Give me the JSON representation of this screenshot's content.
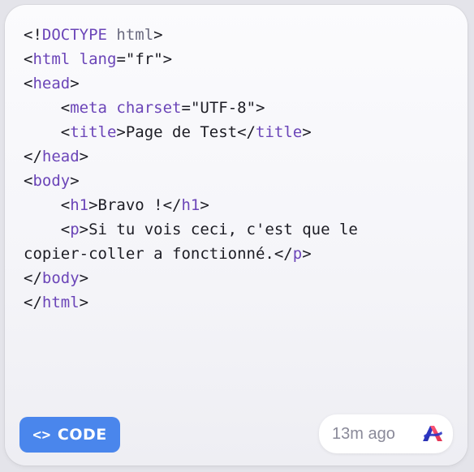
{
  "code_lines": [
    [
      {
        "t": "<!",
        "c": "punct"
      },
      {
        "t": "DOCTYPE",
        "c": "kw"
      },
      {
        "t": " html",
        "c": "dim"
      },
      {
        "t": ">",
        "c": "punct"
      }
    ],
    [
      {
        "t": "<",
        "c": "punct"
      },
      {
        "t": "html",
        "c": "kw"
      },
      {
        "t": " ",
        "c": "punct"
      },
      {
        "t": "lang",
        "c": "at"
      },
      {
        "t": "=\"fr\">",
        "c": "punct"
      }
    ],
    [
      {
        "t": "<",
        "c": "punct"
      },
      {
        "t": "head",
        "c": "kw"
      },
      {
        "t": ">",
        "c": "punct"
      }
    ],
    [
      {
        "t": "    <",
        "c": "punct"
      },
      {
        "t": "meta",
        "c": "kw"
      },
      {
        "t": " ",
        "c": "punct"
      },
      {
        "t": "charset",
        "c": "at"
      },
      {
        "t": "=\"UTF-8\">",
        "c": "punct"
      }
    ],
    [
      {
        "t": "    <",
        "c": "punct"
      },
      {
        "t": "title",
        "c": "kw"
      },
      {
        "t": ">Page de Test</",
        "c": "punct"
      },
      {
        "t": "title",
        "c": "kw"
      },
      {
        "t": ">",
        "c": "punct"
      }
    ],
    [
      {
        "t": "</",
        "c": "punct"
      },
      {
        "t": "head",
        "c": "kw"
      },
      {
        "t": ">",
        "c": "punct"
      }
    ],
    [
      {
        "t": "<",
        "c": "punct"
      },
      {
        "t": "body",
        "c": "kw"
      },
      {
        "t": ">",
        "c": "punct"
      }
    ],
    [
      {
        "t": "    <",
        "c": "punct"
      },
      {
        "t": "h1",
        "c": "kw"
      },
      {
        "t": ">Bravo !</",
        "c": "punct"
      },
      {
        "t": "h1",
        "c": "kw"
      },
      {
        "t": ">",
        "c": "punct"
      }
    ],
    [
      {
        "t": "    <",
        "c": "punct"
      },
      {
        "t": "p",
        "c": "kw"
      },
      {
        "t": ">Si tu vois ceci, c'est que le",
        "c": "punct"
      }
    ],
    [
      {
        "t": "copier-coller a fonctionné.</",
        "c": "punct"
      },
      {
        "t": "p",
        "c": "kw"
      },
      {
        "t": ">",
        "c": "punct"
      }
    ],
    [
      {
        "t": "</",
        "c": "punct"
      },
      {
        "t": "body",
        "c": "kw"
      },
      {
        "t": ">",
        "c": "punct"
      }
    ],
    [
      {
        "t": "</",
        "c": "punct"
      },
      {
        "t": "html",
        "c": "kw"
      },
      {
        "t": ">",
        "c": "punct"
      }
    ]
  ],
  "badge": {
    "icon": "<>",
    "icon_name": "code-brackets-icon",
    "label": "CODE",
    "color": "#4a86ec"
  },
  "meta": {
    "time": "13m ago",
    "logo_icon": "app-logo-icon"
  },
  "colors": {
    "keyword": "#6b45b8",
    "text": "#1c1c24"
  }
}
